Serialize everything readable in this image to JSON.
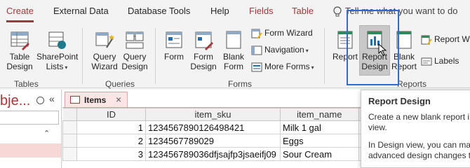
{
  "tabs": [
    "Create",
    "External Data",
    "Database Tools",
    "Help",
    "Fields",
    "Table"
  ],
  "tell_me": "Tell me what you want to do",
  "groups": {
    "tables": {
      "label": "Tables",
      "buttons": [
        {
          "line1": "Table",
          "line2": "Design"
        },
        {
          "line1": "SharePoint",
          "line2": "Lists"
        }
      ]
    },
    "queries": {
      "label": "Queries",
      "buttons": [
        {
          "line1": "Query",
          "line2": "Wizard"
        },
        {
          "line1": "Query",
          "line2": "Design"
        }
      ]
    },
    "forms": {
      "label": "Forms",
      "buttons": [
        {
          "line1": "Form",
          "line2": ""
        },
        {
          "line1": "Form",
          "line2": "Design"
        },
        {
          "line1": "Blank",
          "line2": "Form"
        }
      ],
      "small": [
        "Form Wizard",
        "Navigation",
        "More Forms"
      ]
    },
    "reports": {
      "label": "Reports",
      "buttons": [
        {
          "line1": "Report",
          "line2": ""
        },
        {
          "line1": "Report",
          "line2": "Design"
        },
        {
          "line1": "Blank",
          "line2": "Report"
        }
      ],
      "small": [
        "Report Wi",
        "Labels"
      ]
    }
  },
  "nav": {
    "title": "bje..."
  },
  "sheet": {
    "tab_label": "Items",
    "columns": [
      "ID",
      "item_sku",
      "item_name"
    ],
    "rows": [
      {
        "id": "1",
        "sku": "1234567890126498421",
        "name": "Milk 1 gal"
      },
      {
        "id": "2",
        "sku": "1234567789029",
        "name": "Eggs"
      },
      {
        "id": "3",
        "sku": "123456789036dfjsajfp3jsaeifj09",
        "name": "Sour Cream"
      }
    ]
  },
  "tooltip": {
    "title": "Report Design",
    "lines": [
      "Create a new blank report in",
      "view.",
      "",
      "In Design view, you can ma",
      "advanced design changes to"
    ]
  }
}
